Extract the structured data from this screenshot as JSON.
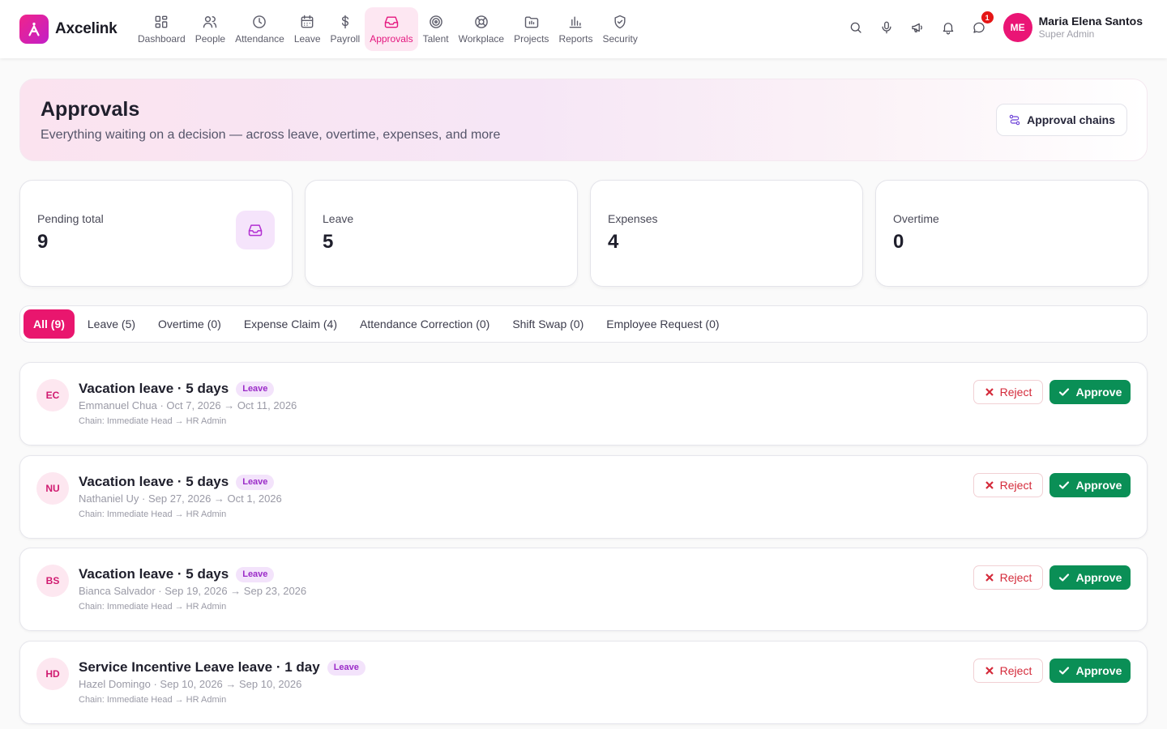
{
  "app": {
    "name": "Axcelink"
  },
  "nav": [
    {
      "label": "Dashboard",
      "icon": "grid-icon",
      "active": false
    },
    {
      "label": "People",
      "icon": "users-icon",
      "active": false
    },
    {
      "label": "Attendance",
      "icon": "clock-icon",
      "active": false
    },
    {
      "label": "Leave",
      "icon": "calendar-icon",
      "active": false
    },
    {
      "label": "Payroll",
      "icon": "dollar-icon",
      "active": false
    },
    {
      "label": "Approvals",
      "icon": "inbox-icon",
      "active": true
    },
    {
      "label": "Talent",
      "icon": "target-icon",
      "active": false
    },
    {
      "label": "Workplace",
      "icon": "lifebuoy-icon",
      "active": false
    },
    {
      "label": "Projects",
      "icon": "folder-icon",
      "active": false
    },
    {
      "label": "Reports",
      "icon": "bar-chart-icon",
      "active": false
    },
    {
      "label": "Security",
      "icon": "shield-icon",
      "active": false
    }
  ],
  "header_actions": {
    "chat_badge": "1"
  },
  "user": {
    "initials": "ME",
    "name": "Maria Elena Santos",
    "role": "Super Admin"
  },
  "hero": {
    "title": "Approvals",
    "subtitle": "Everything waiting on a decision — across leave, overtime, expenses, and more",
    "chains_button": "Approval chains"
  },
  "stats": [
    {
      "label": "Pending total",
      "value": "9"
    },
    {
      "label": "Leave",
      "value": "5"
    },
    {
      "label": "Expenses",
      "value": "4"
    },
    {
      "label": "Overtime",
      "value": "0"
    }
  ],
  "tabs": [
    {
      "label": "All (9)",
      "active": true
    },
    {
      "label": "Leave (5)",
      "active": false
    },
    {
      "label": "Overtime (0)",
      "active": false
    },
    {
      "label": "Expense Claim (4)",
      "active": false
    },
    {
      "label": "Attendance Correction (0)",
      "active": false
    },
    {
      "label": "Shift Swap (0)",
      "active": false
    },
    {
      "label": "Employee Request (0)",
      "active": false
    }
  ],
  "actions": {
    "reject": "Reject",
    "approve": "Approve"
  },
  "requests": [
    {
      "initials": "EC",
      "title": "Vacation leave · 5 days",
      "badge": "Leave",
      "meta": "Emmanuel Chua · Oct 7, 2026 → Oct 11, 2026",
      "chain": "Chain: Immediate Head → HR Admin"
    },
    {
      "initials": "NU",
      "title": "Vacation leave · 5 days",
      "badge": "Leave",
      "meta": "Nathaniel Uy · Sep 27, 2026 → Oct 1, 2026",
      "chain": "Chain: Immediate Head → HR Admin"
    },
    {
      "initials": "BS",
      "title": "Vacation leave · 5 days",
      "badge": "Leave",
      "meta": "Bianca Salvador · Sep 19, 2026 → Sep 23, 2026",
      "chain": "Chain: Immediate Head → HR Admin"
    },
    {
      "initials": "HD",
      "title": "Service Incentive Leave leave · 1 day",
      "badge": "Leave",
      "meta": "Hazel Domingo · Sep 10, 2026 → Sep 10, 2026",
      "chain": "Chain: Immediate Head → HR Admin"
    }
  ]
}
